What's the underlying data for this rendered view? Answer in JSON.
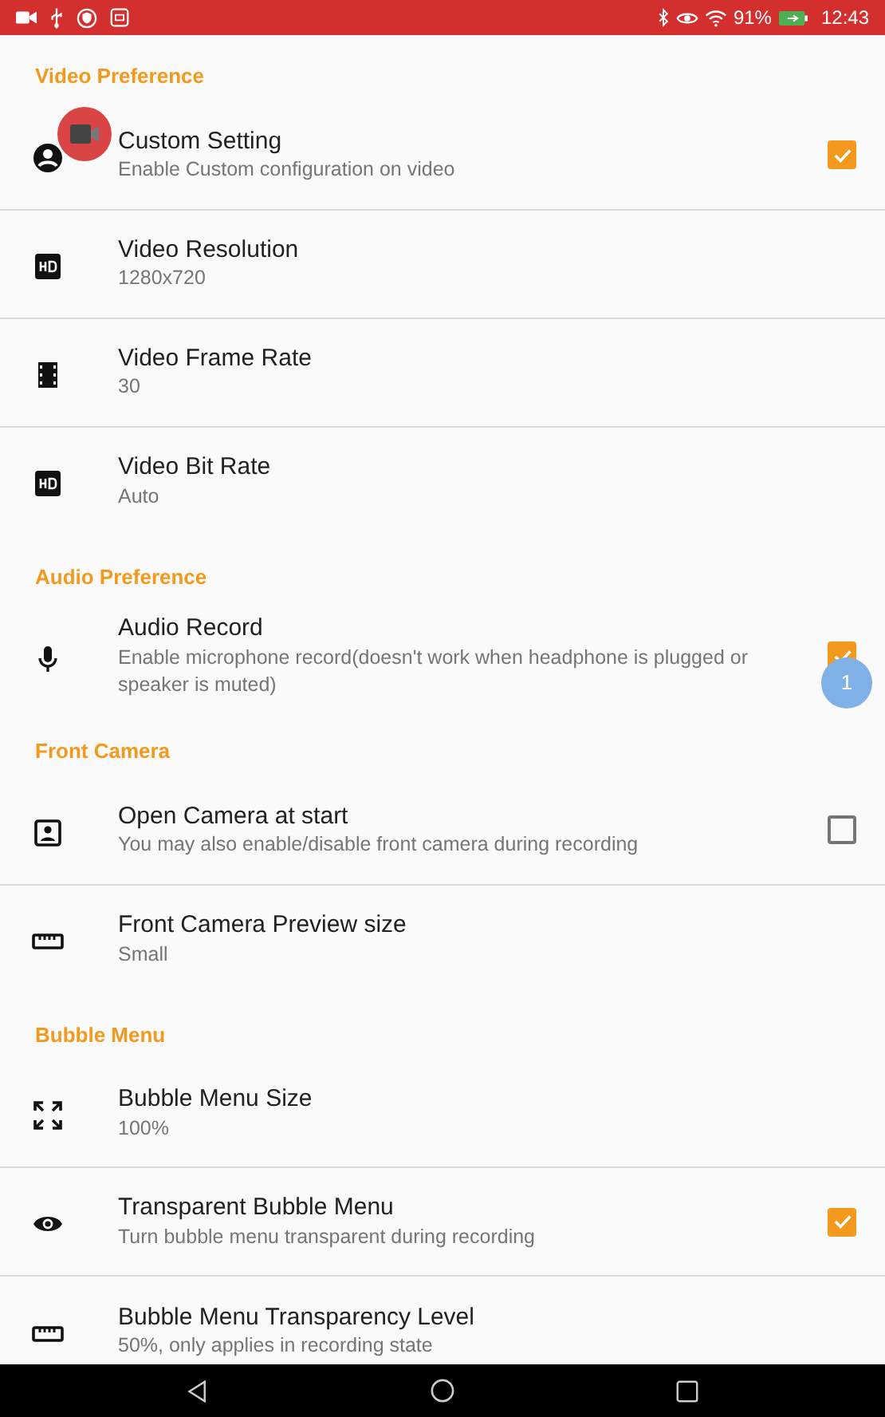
{
  "status_bar": {
    "battery": "91%",
    "time": "12:43"
  },
  "sections": [
    {
      "title": "Video Preference",
      "items": [
        {
          "kind": "checkbox",
          "title": "Custom Setting",
          "summary": "Enable Custom configuration on video",
          "checked": true
        },
        {
          "kind": "value",
          "title": "Video Resolution",
          "summary": "1280x720"
        },
        {
          "kind": "value",
          "title": "Video Frame Rate",
          "summary": "30"
        },
        {
          "kind": "value",
          "title": "Video Bit Rate",
          "summary": "Auto"
        }
      ]
    },
    {
      "title": "Audio Preference",
      "items": [
        {
          "kind": "checkbox",
          "title": "Audio Record",
          "summary": "Enable microphone record(doesn't work when headphone is plugged or speaker is muted)",
          "checked": true
        }
      ]
    },
    {
      "title": "Front Camera",
      "items": [
        {
          "kind": "checkbox",
          "title": "Open Camera at start",
          "summary": "You may also enable/disable front camera during recording",
          "checked": false
        },
        {
          "kind": "value",
          "title": "Front Camera Preview size",
          "summary": "Small"
        }
      ]
    },
    {
      "title": "Bubble Menu",
      "items": [
        {
          "kind": "value",
          "title": "Bubble Menu Size",
          "summary": "100%"
        },
        {
          "kind": "checkbox",
          "title": "Transparent Bubble Menu",
          "summary": "Turn bubble menu transparent during recording",
          "checked": true
        },
        {
          "kind": "value",
          "title": "Bubble Menu Transparency Level",
          "summary": "50%, only applies in recording state"
        }
      ]
    }
  ],
  "floating_badge": {
    "count": "1"
  }
}
